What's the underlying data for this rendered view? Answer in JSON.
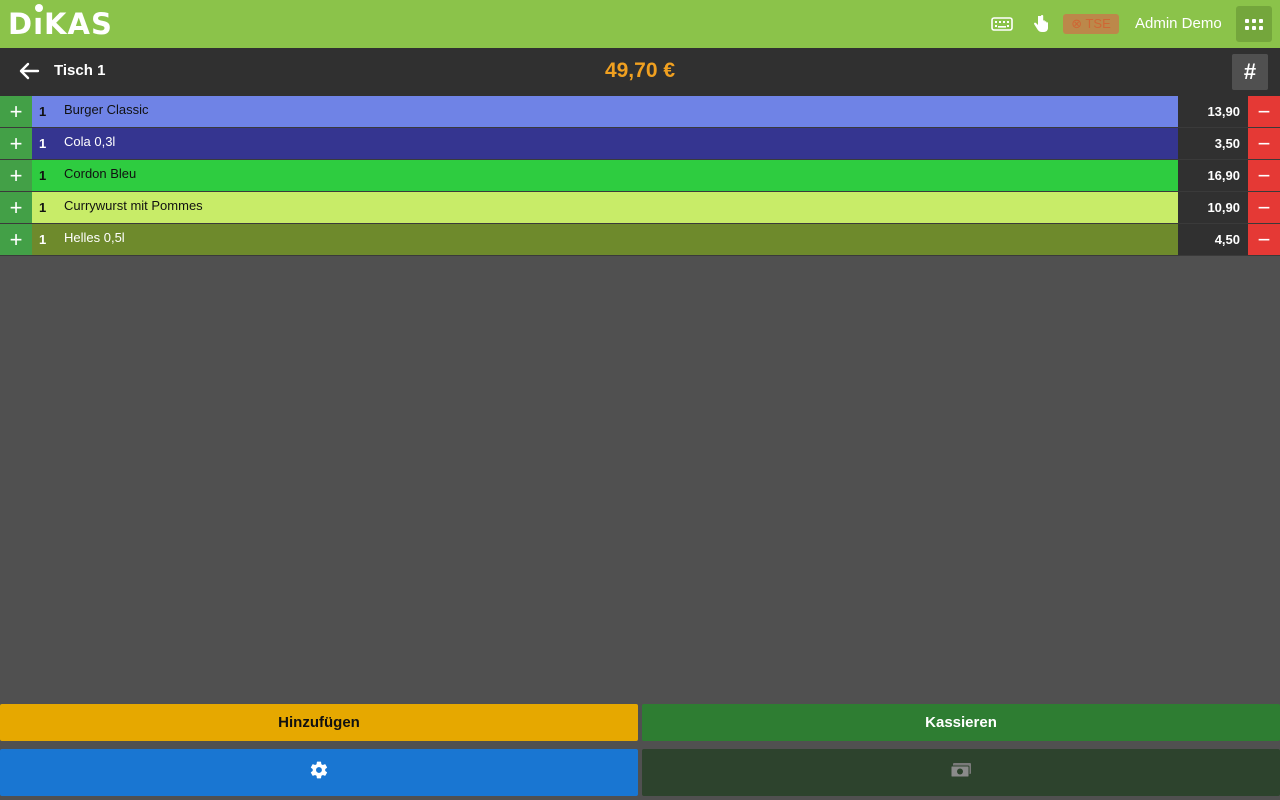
{
  "app": {
    "logo_text": "DIKAS",
    "user_name": "Admin Demo",
    "status_badge": "⊗ TSE"
  },
  "order": {
    "table_name": "Tisch 1",
    "total": "49,70 €",
    "hash_label": "#",
    "items": [
      {
        "qty": "1",
        "name": "Burger Classic",
        "price": "13,90",
        "color": "#6f83e6",
        "text_color": "#111111"
      },
      {
        "qty": "1",
        "name": "Cola 0,3l",
        "price": "3,50",
        "color": "#353590",
        "text_color": "#ffffff"
      },
      {
        "qty": "1",
        "name": "Cordon Bleu",
        "price": "16,90",
        "color": "#2ecc40",
        "text_color": "#111111"
      },
      {
        "qty": "1",
        "name": "Currywurst mit Pommes",
        "price": "10,90",
        "color": "#c8ec68",
        "text_color": "#111111"
      },
      {
        "qty": "1",
        "name": "Helles 0,5l",
        "price": "4,50",
        "color": "#6e8a2c",
        "text_color": "#ffffff"
      }
    ]
  },
  "actions": {
    "add_label": "Hinzufügen",
    "pay_label": "Kassieren"
  },
  "icons": {
    "keyboard": "keyboard-icon",
    "touch": "touch-hand-icon",
    "apps": "apps-grid-icon",
    "back": "arrow-left-icon",
    "settings": "gear-icon",
    "cash": "cash-icon"
  },
  "colors": {
    "topbar": "#8bc34a",
    "total": "#f0a020",
    "plus": "#43a047",
    "minus": "#e53935",
    "add": "#e6a800",
    "pay": "#2e7d32",
    "settings": "#1976d2"
  }
}
